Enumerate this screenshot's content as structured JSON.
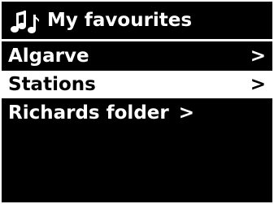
{
  "header": {
    "icon": "music-notes-icon",
    "title": "My favourites"
  },
  "menu": {
    "selected_index": 1,
    "items": [
      {
        "label": "Algarve",
        "arrow": ">"
      },
      {
        "label": "Stations",
        "arrow": ">"
      },
      {
        "label": "Richards folder",
        "arrow": ">"
      }
    ]
  },
  "colors": {
    "background": "#000000",
    "foreground": "#ffffff",
    "highlight_bg": "#ffffff",
    "highlight_fg": "#000000"
  }
}
